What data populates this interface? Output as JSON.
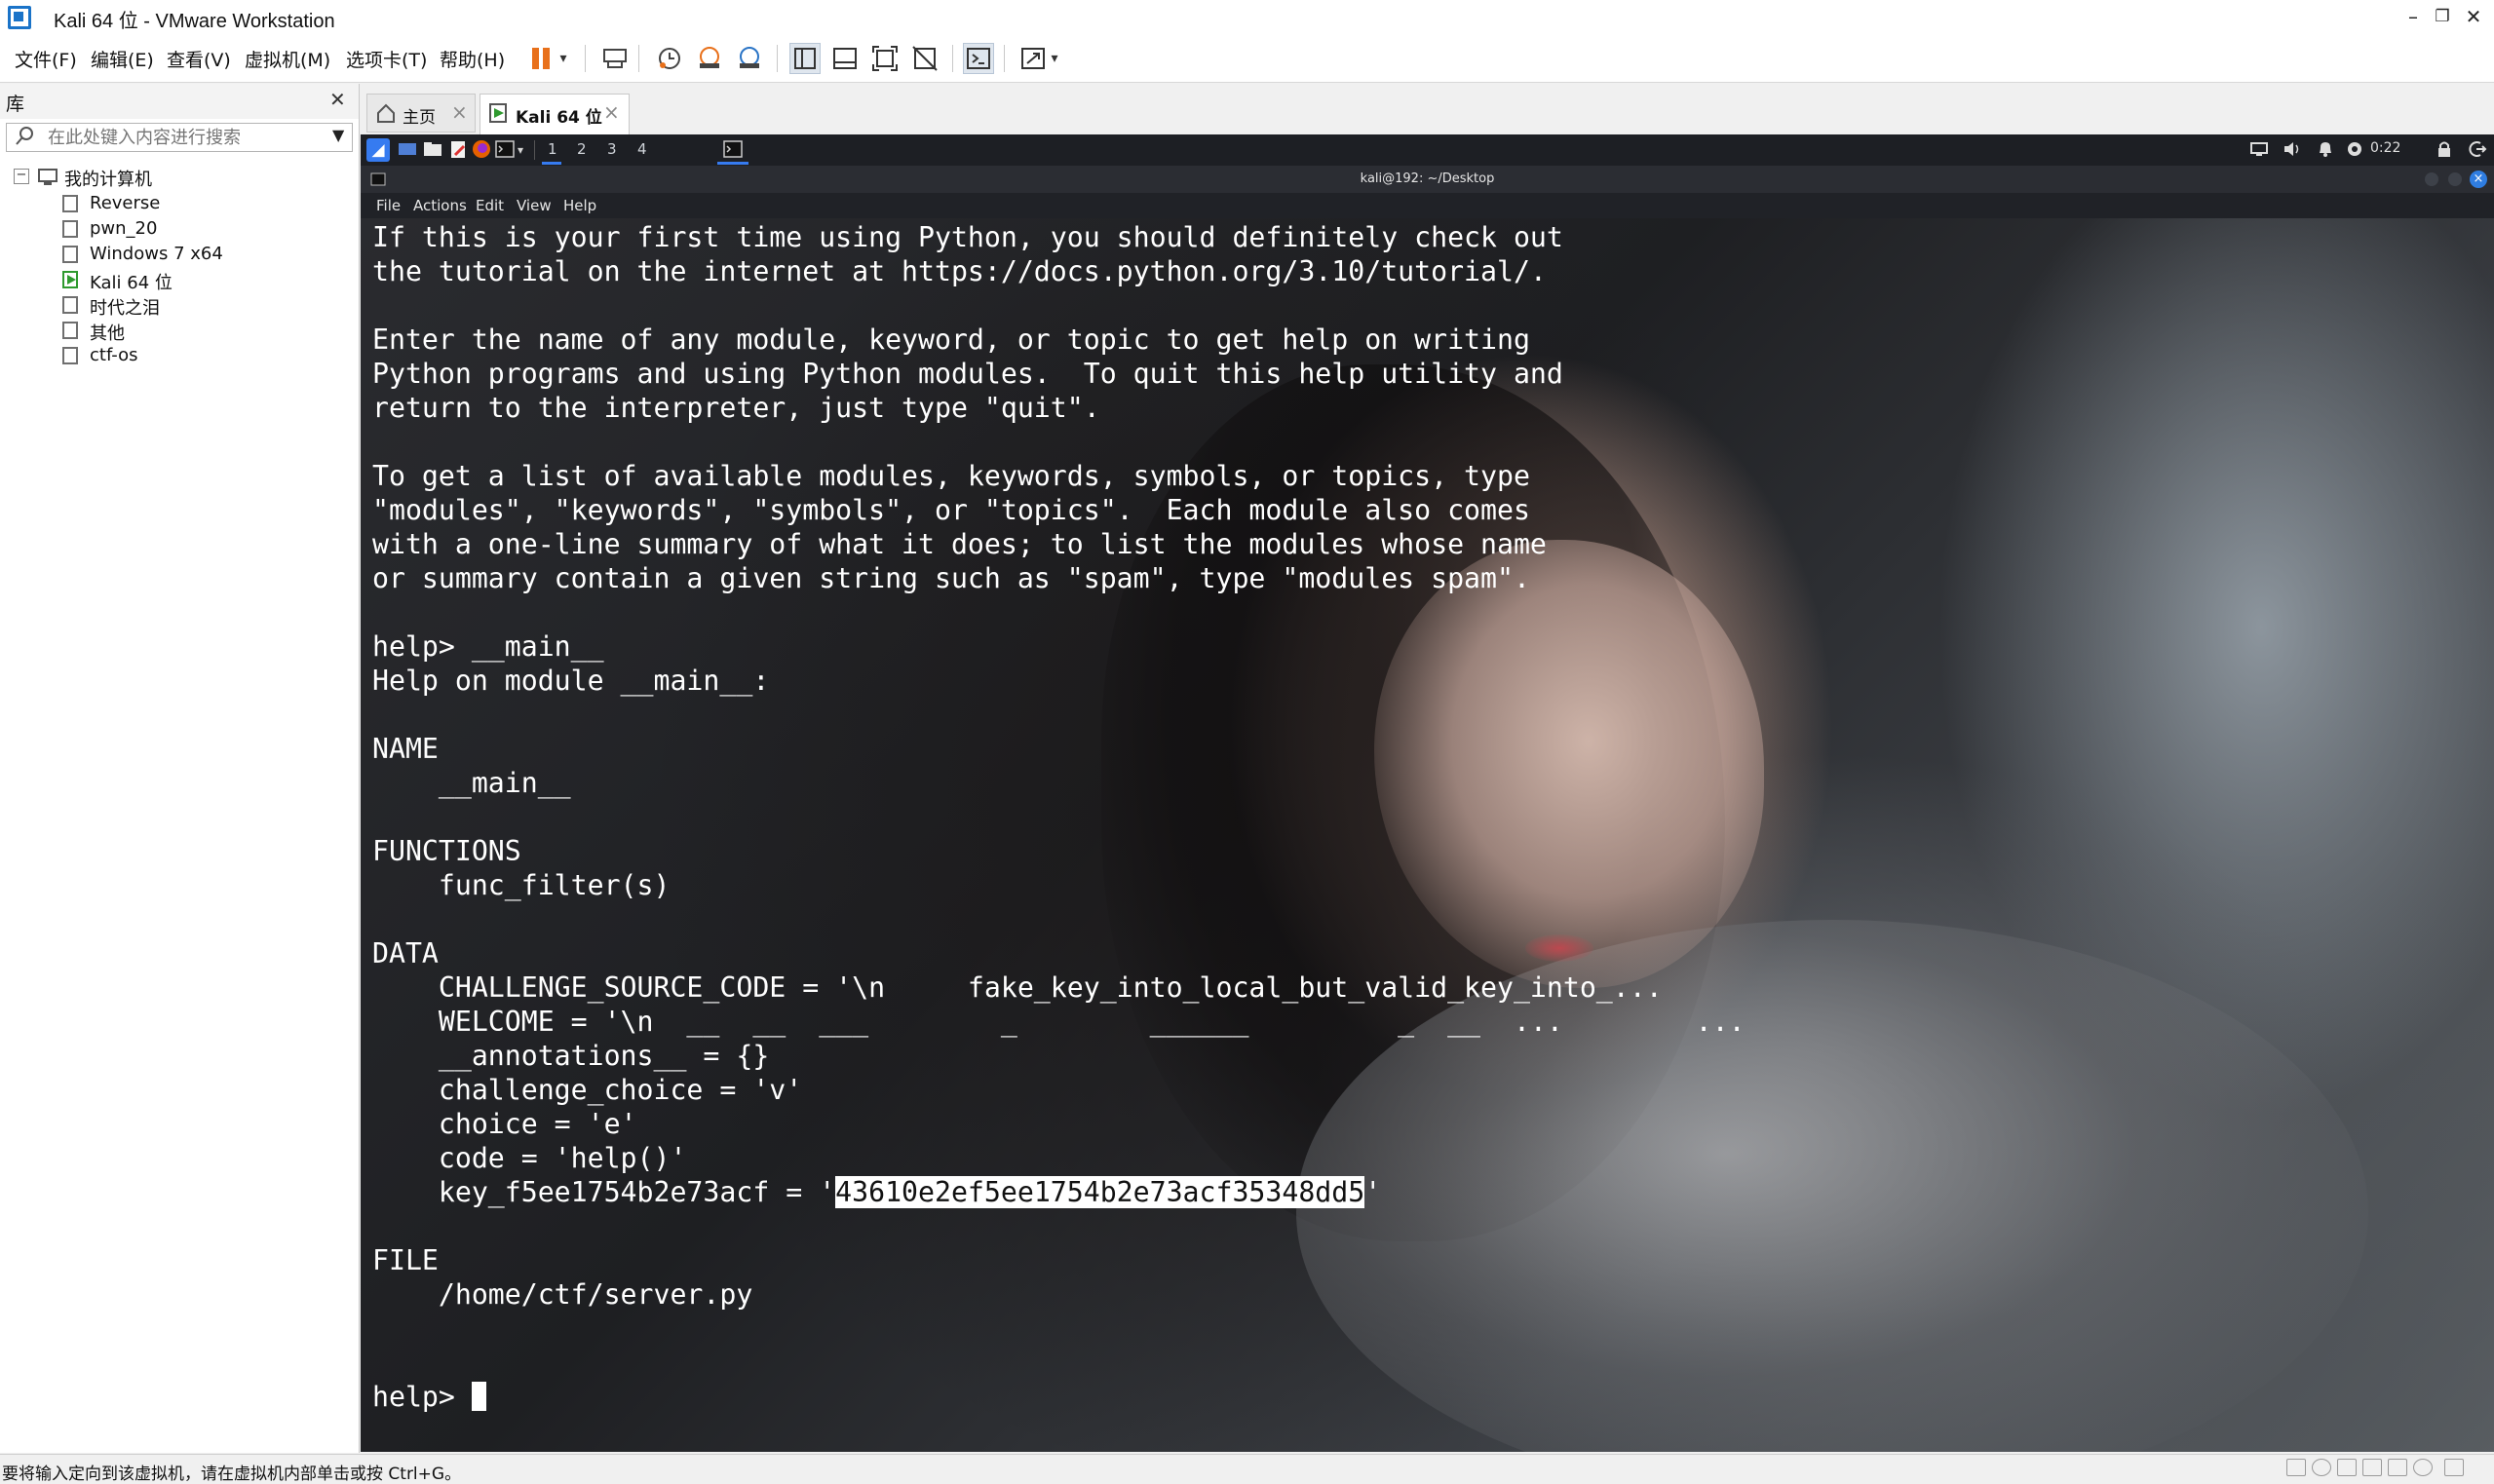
{
  "window": {
    "title": "Kali 64 位 - VMware Workstation",
    "minimize_glyph": "–",
    "restore_glyph": "❐",
    "close_glyph": "✕"
  },
  "menu": {
    "items": [
      "文件(F)",
      "编辑(E)",
      "查看(V)",
      "虚拟机(M)",
      "选项卡(T)",
      "帮助(H)"
    ]
  },
  "toolbar": {
    "icons": [
      "pause-icon",
      "send-ctrl-alt-del-icon",
      "snapshot-icon",
      "revert-snapshot-icon",
      "snapshot-manager-icon",
      "show-library-icon",
      "thumbnail-bar-icon",
      "fullscreen-icon",
      "unity-icon",
      "console-icon",
      "stretch-icon"
    ]
  },
  "library": {
    "title": "库",
    "close_glyph": "✕",
    "search_placeholder": "在此处键入内容进行搜索",
    "root": "我的计算机",
    "vms": [
      {
        "name": "Reverse",
        "running": false
      },
      {
        "name": "pwn_20",
        "running": false
      },
      {
        "name": "Windows 7 x64",
        "running": false
      },
      {
        "name": "Kali 64 位",
        "running": true
      },
      {
        "name": "时代之泪",
        "running": false
      },
      {
        "name": "其他",
        "running": false
      },
      {
        "name": "ctf-os",
        "running": false
      }
    ]
  },
  "tabs": [
    {
      "label": "主页",
      "active": false
    },
    {
      "label": "Kali 64 位",
      "active": true
    }
  ],
  "kali_panel": {
    "workspaces": [
      "1",
      "2",
      "3",
      "4"
    ],
    "time": "0:22"
  },
  "terminal": {
    "title": "kali@192: ~/Desktop",
    "menu": [
      "File",
      "Actions",
      "Edit",
      "View",
      "Help"
    ],
    "lines": [
      "If this is your first time using Python, you should definitely check out",
      "the tutorial on the internet at https://docs.python.org/3.10/tutorial/.",
      "",
      "Enter the name of any module, keyword, or topic to get help on writing",
      "Python programs and using Python modules.  To quit this help utility and",
      "return to the interpreter, just type \"quit\".",
      "",
      "To get a list of available modules, keywords, symbols, or topics, type",
      "\"modules\", \"keywords\", \"symbols\", or \"topics\".  Each module also comes",
      "with a one-line summary of what it does; to list the modules whose name",
      "or summary contain a given string such as \"spam\", type \"modules spam\".",
      "",
      "help> __main__",
      "Help on module __main__:",
      "",
      "NAME",
      "    __main__",
      "",
      "FUNCTIONS",
      "    func_filter(s)",
      "",
      "DATA",
      "    CHALLENGE_SOURCE_CODE = '\\n     fake_key_into_local_but_valid_key_into_...",
      "    WELCOME = '\\n  __  __  ___        _        ______         _  __  ...        ...",
      "    __annotations__ = {}",
      "    challenge_choice = 'v'",
      "    choice = 'e'",
      "    code = 'help()'"
    ],
    "key_line": {
      "prefix": "    key_f5ee1754b2e73acf = '",
      "value": "43610e2ef5ee1754b2e73acf35348dd5",
      "suffix": "'"
    },
    "tail_lines": [
      "",
      "FILE",
      "    /home/ctf/server.py",
      "",
      ""
    ],
    "prompt": "help> "
  },
  "statusbar": {
    "text": "要将输入定向到该虚拟机，请在虚拟机内部单击或按 Ctrl+G。"
  }
}
